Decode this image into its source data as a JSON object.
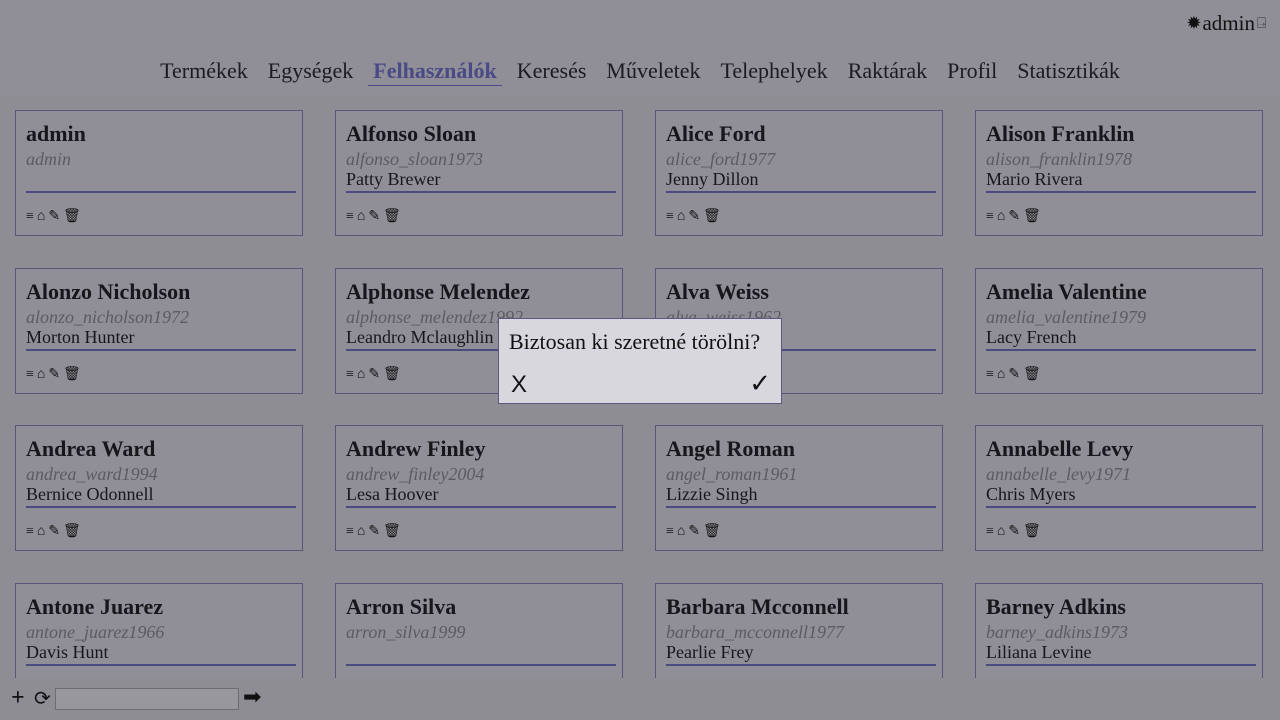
{
  "header": {
    "user": {
      "icon": "sun-icon",
      "name": "admin",
      "logout_icon": "logout-icon"
    },
    "nav": [
      {
        "label": "Termékek",
        "active": false
      },
      {
        "label": "Egységek",
        "active": false
      },
      {
        "label": "Felhasználók",
        "active": true
      },
      {
        "label": "Keresés",
        "active": false
      },
      {
        "label": "Műveletek",
        "active": false
      },
      {
        "label": "Telephelyek",
        "active": false
      },
      {
        "label": "Raktárak",
        "active": false
      },
      {
        "label": "Profil",
        "active": false
      },
      {
        "label": "Statisztikák",
        "active": false
      }
    ],
    "accent_color": "#4a4a86"
  },
  "users": [
    {
      "name": "admin",
      "username": "admin",
      "manager": ""
    },
    {
      "name": "Alfonso Sloan",
      "username": "alfonso_sloan1973",
      "manager": "Patty Brewer"
    },
    {
      "name": "Alice Ford",
      "username": "alice_ford1977",
      "manager": "Jenny Dillon"
    },
    {
      "name": "Alison Franklin",
      "username": "alison_franklin1978",
      "manager": "Mario Rivera"
    },
    {
      "name": "Alonzo Nicholson",
      "username": "alonzo_nicholson1972",
      "manager": "Morton Hunter"
    },
    {
      "name": "Alphonse Melendez",
      "username": "alphonse_melendez1992",
      "manager": "Leandro Mclaughlin"
    },
    {
      "name": "Alva Weiss",
      "username": "alva_weiss1962",
      "manager": ""
    },
    {
      "name": "Amelia Valentine",
      "username": "amelia_valentine1979",
      "manager": "Lacy French"
    },
    {
      "name": "Andrea Ward",
      "username": "andrea_ward1994",
      "manager": "Bernice Odonnell"
    },
    {
      "name": "Andrew Finley",
      "username": "andrew_finley2004",
      "manager": "Lesa Hoover"
    },
    {
      "name": "Angel Roman",
      "username": "angel_roman1961",
      "manager": "Lizzie Singh"
    },
    {
      "name": "Annabelle Levy",
      "username": "annabelle_levy1971",
      "manager": "Chris Myers"
    },
    {
      "name": "Antone Juarez",
      "username": "antone_juarez1966",
      "manager": "Davis Hunt"
    },
    {
      "name": "Arron Silva",
      "username": "arron_silva1999",
      "manager": ""
    },
    {
      "name": "Barbara Mcconnell",
      "username": "barbara_mcconnell1977",
      "manager": "Pearlie Frey"
    },
    {
      "name": "Barney Adkins",
      "username": "barney_adkins1973",
      "manager": "Liliana Levine"
    }
  ],
  "card_actions": {
    "list": {
      "icon": "list-icon",
      "glyph": "≡"
    },
    "warehouse": {
      "icon": "warehouse-icon",
      "glyph": "⌂"
    },
    "edit": {
      "icon": "pencil-icon",
      "glyph": "✎"
    },
    "delete": {
      "icon": "trash-icon",
      "glyph": "🗑"
    }
  },
  "bottom_bar": {
    "add_icon": "plus-icon",
    "refresh_icon": "refresh-icon",
    "search_value": "",
    "go_icon": "arrow-right-icon"
  },
  "dialog": {
    "question": "Biztosan ki szeretné törölni?",
    "cancel_label": "X",
    "confirm_label": "✓"
  }
}
